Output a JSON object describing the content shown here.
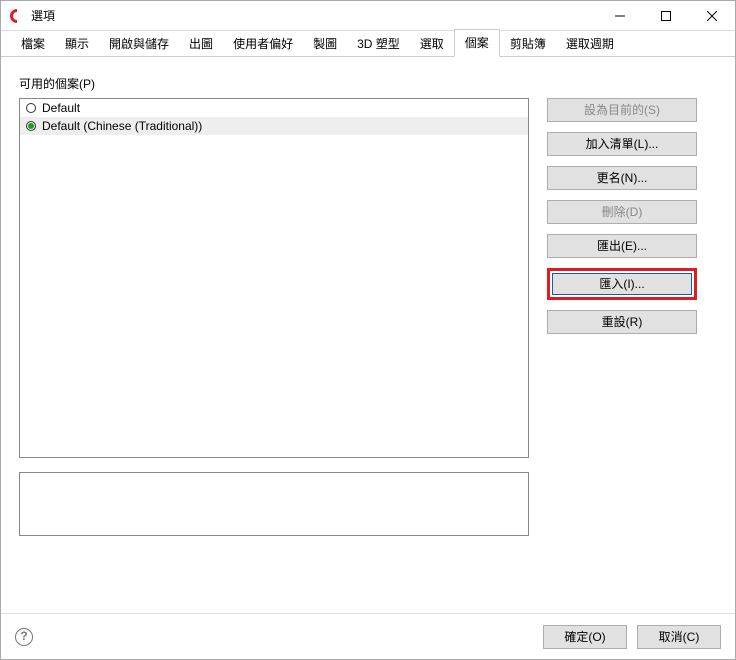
{
  "window": {
    "title": "選項"
  },
  "tabs": {
    "t0": "檔案",
    "t1": "顯示",
    "t2": "開啟與儲存",
    "t3": "出圖",
    "t4": "使用者偏好",
    "t5": "製圖",
    "t6": "3D 塑型",
    "t7": "選取",
    "t8": "個案",
    "t9": "剪貼簿",
    "t10": "選取週期"
  },
  "section": {
    "available_profiles": "可用的個案(P)"
  },
  "profiles": {
    "item0": "Default",
    "item1": "Default (Chinese (Traditional))"
  },
  "buttons": {
    "set_current": "設為目前的(S)",
    "add_to_list": "加入清單(L)...",
    "rename": "更名(N)...",
    "delete": "刪除(D)",
    "export": "匯出(E)...",
    "import": "匯入(I)...",
    "reset": "重設(R)",
    "ok": "確定(O)",
    "cancel": "取消(C)"
  }
}
